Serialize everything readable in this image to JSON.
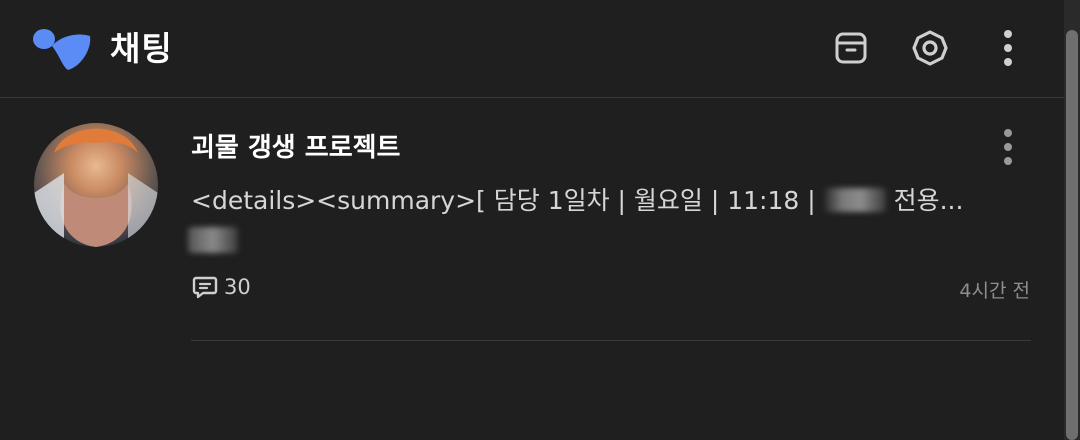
{
  "header": {
    "title": "채팅",
    "icons": {
      "logo": "app-logo-icon",
      "archive": "archive-icon",
      "settings": "settings-icon",
      "more": "more-vertical-icon"
    }
  },
  "chats": [
    {
      "title": "괴물 갱생 프로젝트",
      "preview_prefix": "<details><summary>[ 담당 1일차 | 월요일 | 11:18 |",
      "preview_suffix": "전용...",
      "comment_count": "30",
      "timestamp": "4시간 전"
    }
  ],
  "colors": {
    "logo": "#5b8cf5",
    "background": "#1f1f1f",
    "divider": "#3a3a3a"
  }
}
